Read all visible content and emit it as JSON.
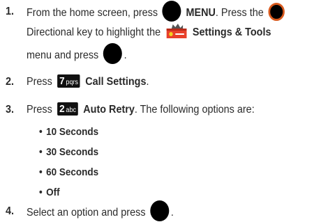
{
  "steps": {
    "n1": "1.",
    "s1_a": "From the home screen, press",
    "s1_menu": "MENU",
    "s1_b": ". Press the",
    "s1_c": "Directional key to highlight the",
    "s1_settings": "Settings & Tools",
    "s1_d": "menu and press",
    "s1_e": ".",
    "n2": "2.",
    "s2_press": "Press",
    "s2_key": "7",
    "s2_key_letters": "pqrs",
    "s2_label": "Call Settings",
    "s2_end": ".",
    "n3": "3.",
    "s3_press": "Press",
    "s3_key": "2",
    "s3_key_letters": "abc",
    "s3_label": "Auto Retry",
    "s3_end": ". The following options are:",
    "options": [
      "10 Seconds",
      "30 Seconds",
      "60 Seconds",
      "Off"
    ],
    "n4": "4.",
    "s4_text": "Select an option and press",
    "s4_end": "."
  },
  "icons": {
    "ok_button": "black-circle-button-icon",
    "directional_key": "directional-key-icon",
    "settings_tools": "settings-tools-icon",
    "key_7": "key-7-icon",
    "key_2": "key-2-icon"
  },
  "colors": {
    "text": "#2a2a2a",
    "accent_ring": "#d85a1e",
    "toolbox": "#e8402a"
  }
}
